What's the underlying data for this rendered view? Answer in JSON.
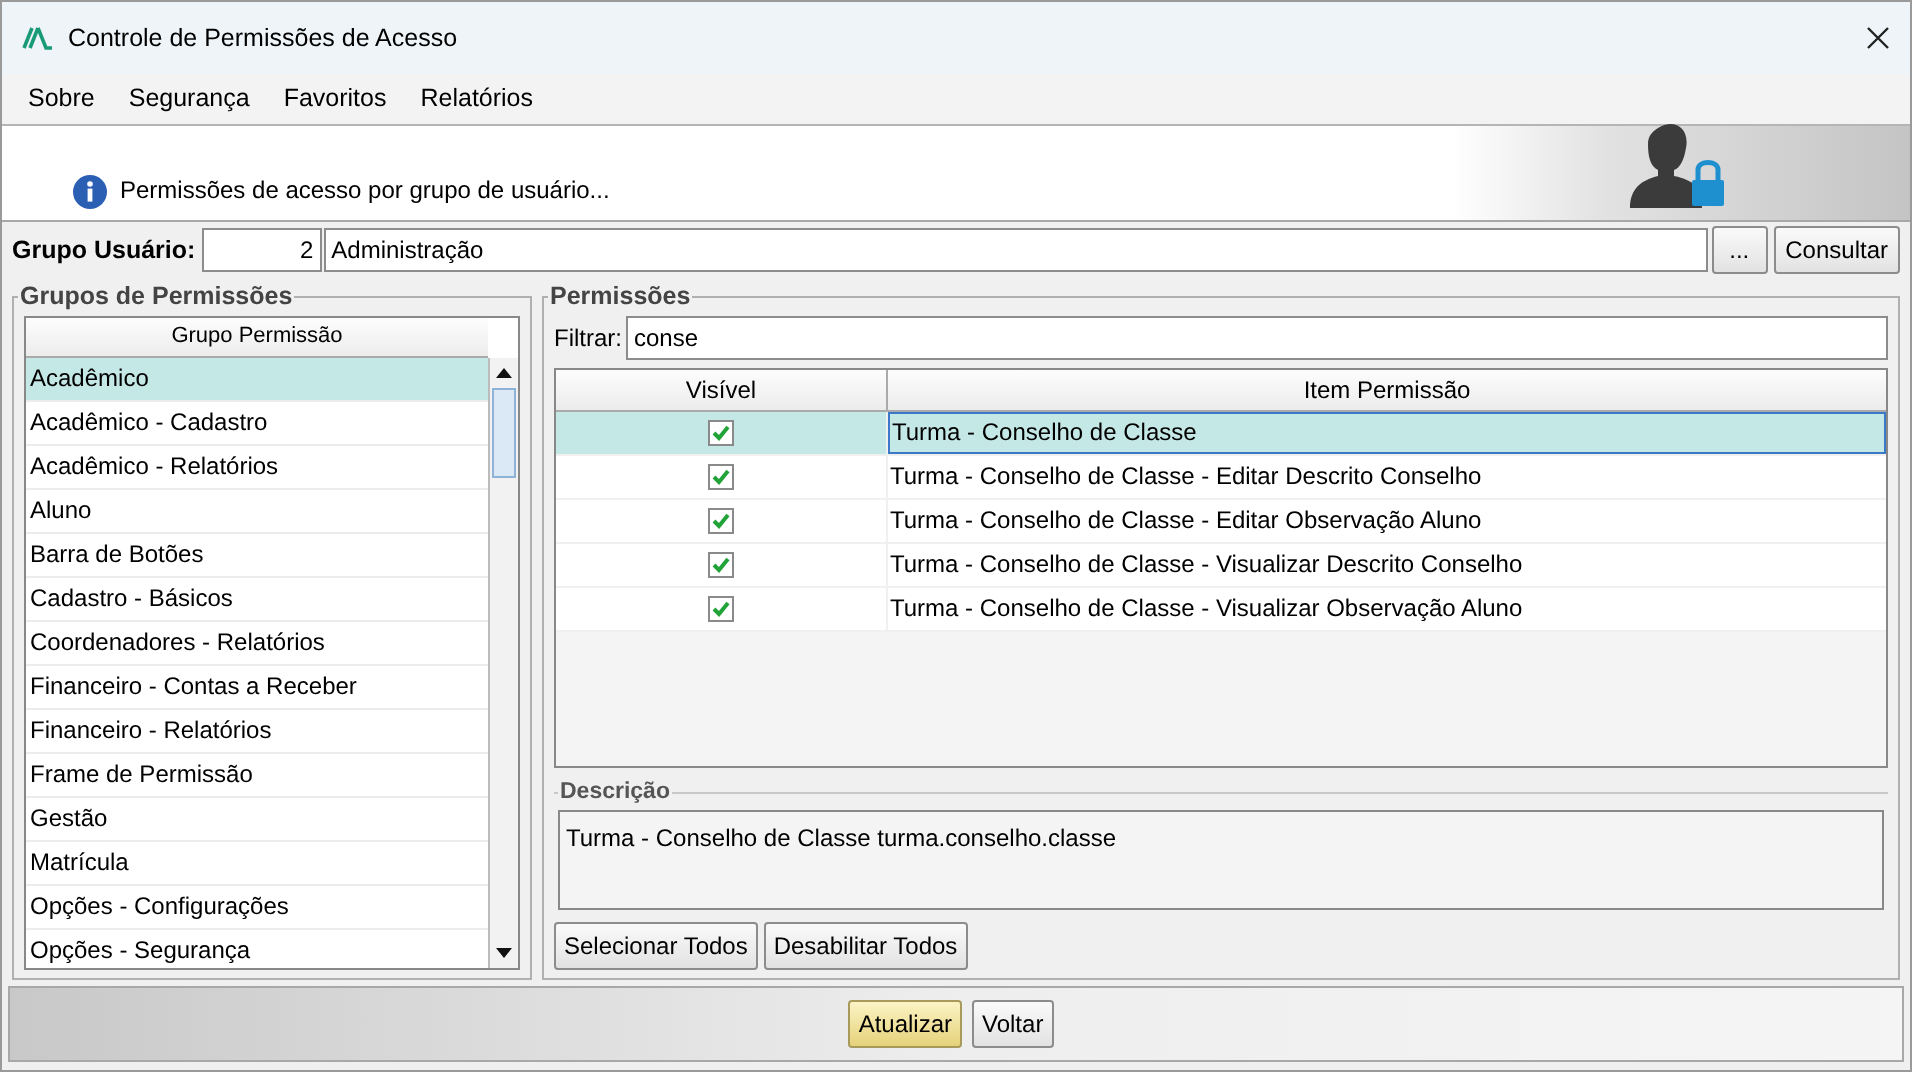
{
  "window": {
    "title": "Controle de Permissões de Acesso"
  },
  "menu": [
    "Sobre",
    "Segurança",
    "Favoritos",
    "Relatórios"
  ],
  "banner": {
    "message": "Permissões de acesso por grupo de usuário..."
  },
  "user_group": {
    "label": "Grupo Usuário:",
    "code": "2",
    "name": "Administração",
    "browse_button": "...",
    "query_button": "Consultar"
  },
  "groups_panel": {
    "title": "Grupos de Permissões",
    "column": "Grupo Permissão",
    "items": [
      {
        "label": "Acadêmico",
        "selected": true
      },
      {
        "label": "Acadêmico - Cadastro",
        "selected": false
      },
      {
        "label": "Acadêmico - Relatórios",
        "selected": false
      },
      {
        "label": "Aluno",
        "selected": false
      },
      {
        "label": "Barra de Botões",
        "selected": false
      },
      {
        "label": "Cadastro - Básicos",
        "selected": false
      },
      {
        "label": "Coordenadores - Relatórios",
        "selected": false
      },
      {
        "label": "Financeiro - Contas a Receber",
        "selected": false
      },
      {
        "label": "Financeiro - Relatórios",
        "selected": false
      },
      {
        "label": "Frame de Permissão",
        "selected": false
      },
      {
        "label": "Gestão",
        "selected": false
      },
      {
        "label": "Matrícula",
        "selected": false
      },
      {
        "label": "Opções - Configurações",
        "selected": false
      },
      {
        "label": "Opções - Segurança",
        "selected": false
      }
    ]
  },
  "permissions_panel": {
    "title": "Permissões",
    "filter_label": "Filtrar:",
    "filter_value": "conse",
    "columns": [
      "Visível",
      "Item Permissão"
    ],
    "rows": [
      {
        "item": "Turma - Conselho de Classe",
        "checked": true,
        "selected": true
      },
      {
        "item": "Turma - Conselho de Classe - Editar Descrito Conselho",
        "checked": true,
        "selected": false
      },
      {
        "item": "Turma - Conselho de Classe - Editar Observação Aluno",
        "checked": true,
        "selected": false
      },
      {
        "item": "Turma - Conselho de Classe - Visualizar Descrito Conselho",
        "checked": true,
        "selected": false
      },
      {
        "item": "Turma - Conselho de Classe - Visualizar Observação Aluno",
        "checked": true,
        "selected": false
      }
    ],
    "description_title": "Descrição",
    "description": "Turma - Conselho de Classe turma.conselho.classe",
    "buttons": [
      "Selecionar Todos",
      "Desabilitar Todos"
    ]
  },
  "footer_buttons": [
    {
      "label": "Atualizar",
      "kind": "primary"
    },
    {
      "label": "Voltar",
      "kind": "normal"
    }
  ]
}
